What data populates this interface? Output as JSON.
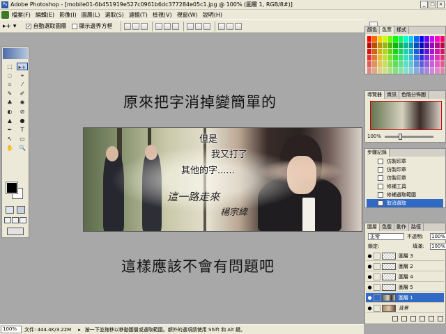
{
  "window": {
    "title": "Adobe Photoshop - [mobile01-6b451919e527c0961b6dc377284e05c1.jpg @ 100% (圖層 1, RGB/8#)]",
    "app_icon": "Ps",
    "controls": [
      "_",
      "□",
      "×"
    ]
  },
  "menu": [
    "檔案(F)",
    "編輯(E)",
    "影像(I)",
    "圖層(L)",
    "選取(S)",
    "濾鏡(T)",
    "檢視(V)",
    "視窗(W)",
    "說明(H)"
  ],
  "options": {
    "tool_glyph": "▸+ ▾",
    "auto_select_label": "自動選取圖層",
    "auto_select_checked": "✓",
    "show_bounds_label": "顯示邊界方框"
  },
  "tools": [
    "⬚",
    "▸+",
    "◌",
    "⌖",
    "⌗",
    "⁄",
    "✎",
    "✐",
    "♣",
    "✺",
    "◐",
    "⊘",
    "▲",
    "●",
    "✒",
    "T",
    "↖",
    "▭",
    "✋",
    "🔍"
  ],
  "canvas": {
    "caption_top": "原來把字消掉變簡單的",
    "caption_bottom": "這樣應該不會有問題吧",
    "image_text_1": "但是",
    "image_text_2": "我又打了",
    "image_text_3": "其他的字......",
    "script_line_1": "這一路走來",
    "script_line_2": "楊宗緯"
  },
  "panels": {
    "swatches_tabs": [
      "顏色",
      "色票",
      "樣式"
    ],
    "navigator_tabs": [
      "導覽器",
      "資訊",
      "色階分佈圖"
    ],
    "navigator_zoom": "100%",
    "history_tabs": [
      "步驟記錄"
    ],
    "history_items": [
      "仿製印章",
      "仿製印章",
      "仿製印章",
      "修補工具",
      "修補選取範圍",
      "取消選取"
    ],
    "layers_tabs": [
      "圖層",
      "色版",
      "動作",
      "路徑"
    ],
    "blend_mode": "正常",
    "opacity_label": "不透明:",
    "opacity_value": "100%",
    "lock_label": "鎖定:",
    "fill_label": "填滿:",
    "fill_value": "100%",
    "layers": [
      "圖層 3",
      "圖層 2",
      "圖層 4",
      "圖層 5",
      "圖層 1",
      "背景"
    ],
    "selected_layer": "圖層 1"
  },
  "status": {
    "zoom": "100%",
    "doc": "文件: 444.4K/3.22M",
    "arrow": "▸",
    "hint": "按一下並拖移以移動圖層或選取範圍。額外的選項請使用 Shift 和 Alt 鍵。"
  },
  "colors": {
    "foreground": "#000000",
    "background": "#ffffff",
    "selection": "#316ac5",
    "workspace": "#a8a8a8"
  }
}
